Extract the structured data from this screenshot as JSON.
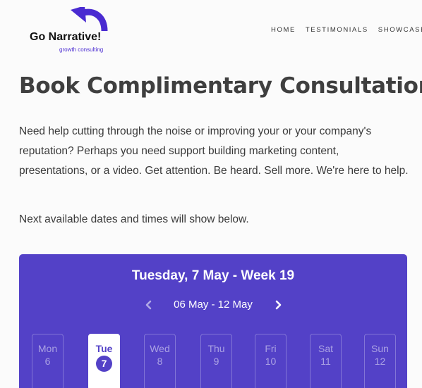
{
  "brand": {
    "name": "Go Narrative!",
    "tagline": "growth consulting",
    "accent_color": "#5341c7",
    "logo_icon": "curved-arrow-logo-icon"
  },
  "nav": {
    "items": [
      {
        "label": "HOME"
      },
      {
        "label": "TESTIMONIALS"
      },
      {
        "label": "SHOWCASE"
      }
    ]
  },
  "page": {
    "title": "Book Complimentary Consultation",
    "intro": "Need help cutting through the noise or improving your or your company's reputation? Perhaps you need support building marketing content, presentations, or a video. Get attention. Be heard. Sell more. We're here to help.",
    "note": "Next available dates and times will show below."
  },
  "booking": {
    "selected_date": "Tuesday, 7 May - Week 19",
    "week_range": "06 May - 12 May",
    "prev_icon": "chevron-left-icon",
    "next_icon": "chevron-right-icon",
    "days": [
      {
        "name": "Mon",
        "num": "6",
        "selected": false
      },
      {
        "name": "Tue",
        "num": "7",
        "selected": true
      },
      {
        "name": "Wed",
        "num": "8",
        "selected": false
      },
      {
        "name": "Thu",
        "num": "9",
        "selected": false
      },
      {
        "name": "Fri",
        "num": "10",
        "selected": false
      },
      {
        "name": "Sat",
        "num": "11",
        "selected": false
      },
      {
        "name": "Sun",
        "num": "12",
        "selected": false
      }
    ]
  }
}
